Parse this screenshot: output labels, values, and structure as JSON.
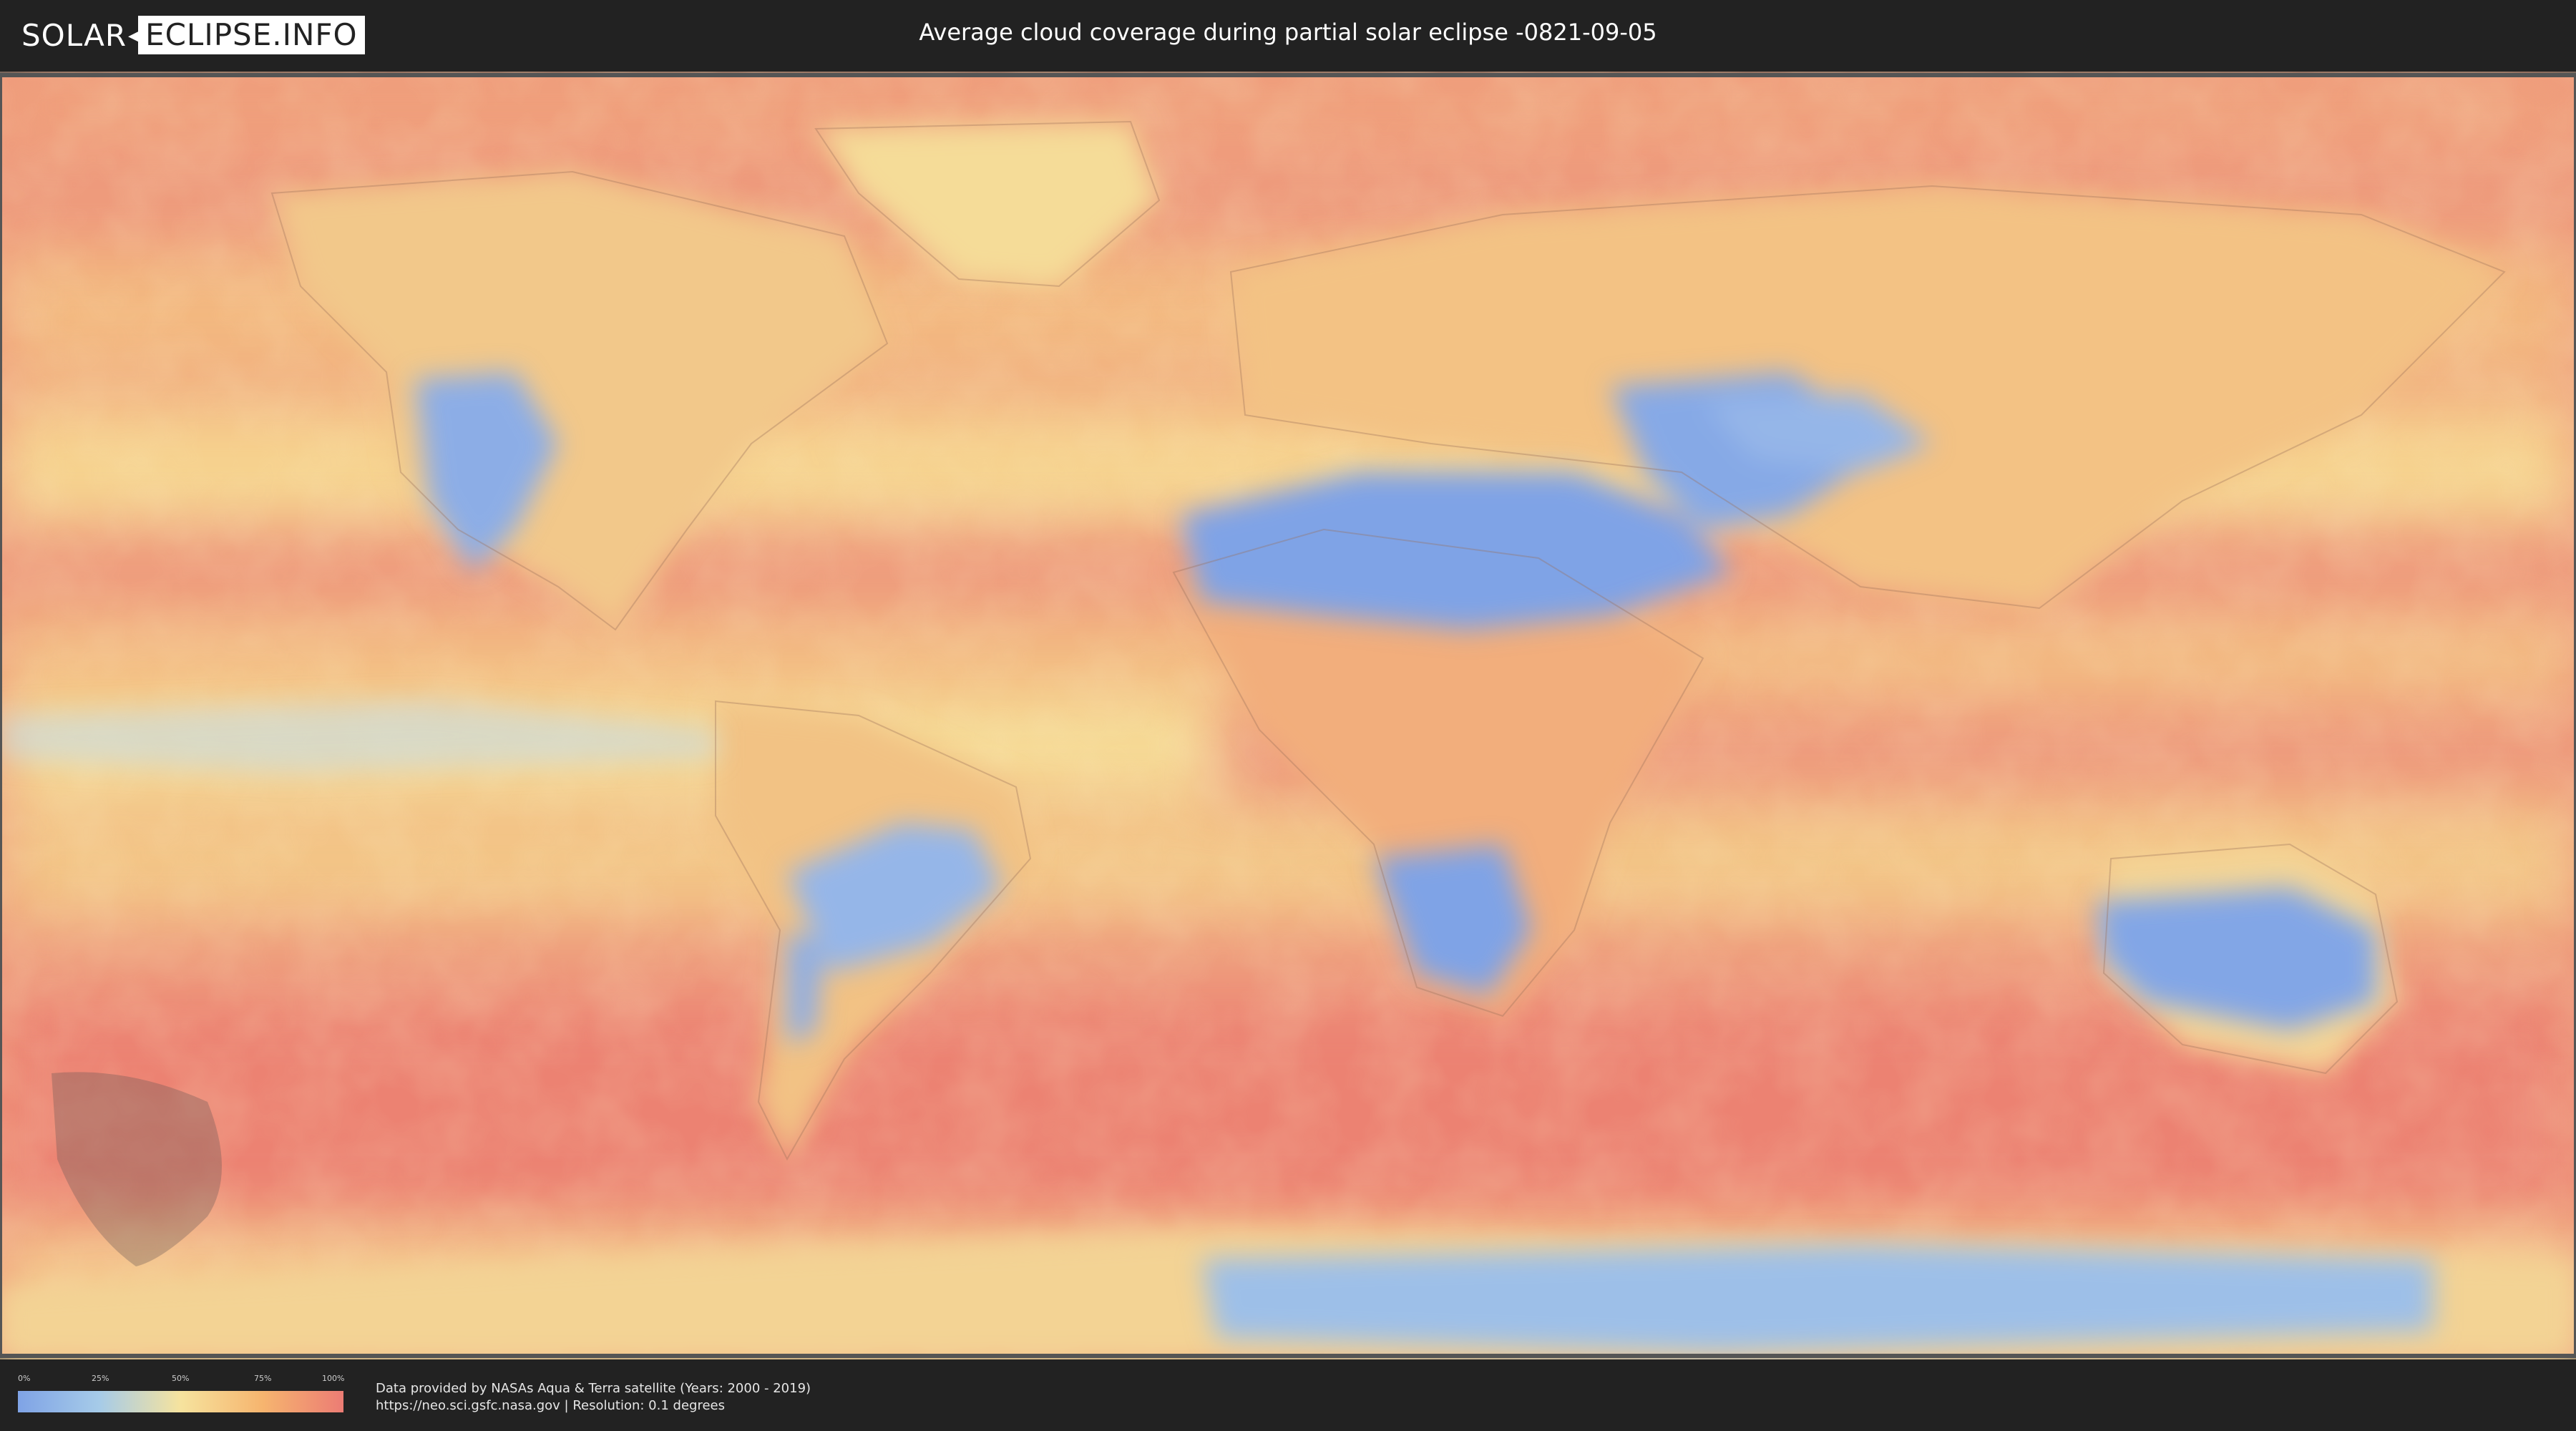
{
  "header": {
    "logo_left": "SOLAR",
    "logo_right": "ECLIPSE.INFO",
    "title": "Average cloud coverage during partial solar eclipse -0821-09-05"
  },
  "legend": {
    "ticks": [
      "0%",
      "25%",
      "50%",
      "75%",
      "100%"
    ],
    "colors": [
      "#7fa3e6",
      "#a6cbe8",
      "#f6e39e",
      "#f6b56f",
      "#ec7c74"
    ]
  },
  "credits": {
    "line1": "Data provided by NASAs Aqua & Terra satellite (Years: 2000 - 2019)",
    "line2": "https://neo.sci.gsfc.nasa.gov | Resolution: 0.1 degrees"
  },
  "colors": {
    "background": "#222222",
    "ocean_cloudy": "#ec8a78",
    "mid_cloud": "#f4c98a",
    "clear_sky": "#7fa3e6"
  }
}
